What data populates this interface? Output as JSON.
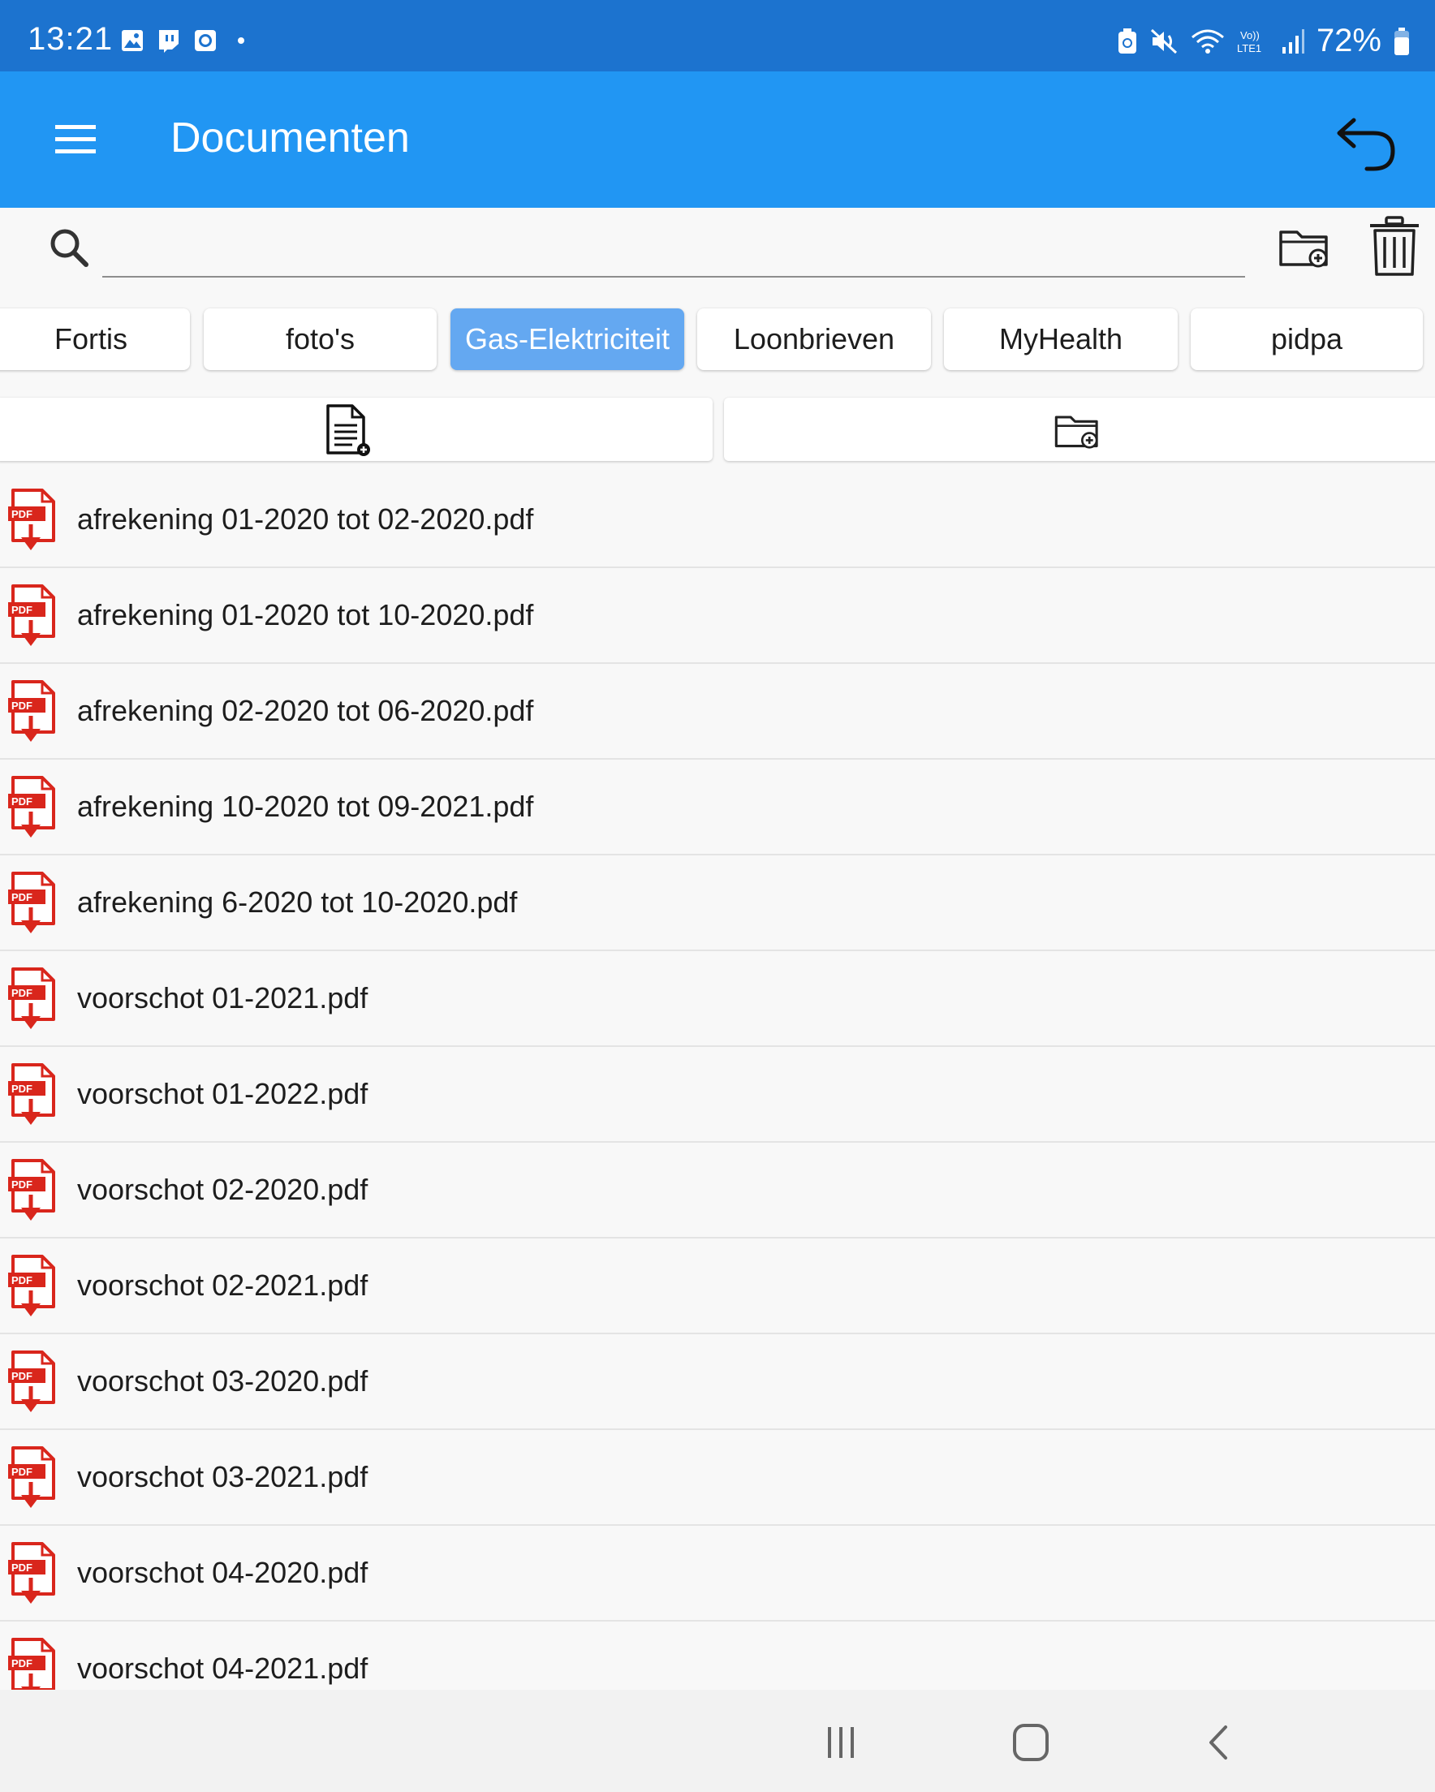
{
  "status_bar": {
    "time": "13:21",
    "battery": "72%",
    "icons": [
      "gallery-icon",
      "twitch-icon",
      "clock-app-icon",
      "dot-icon",
      "battery-saver-icon",
      "mute-icon",
      "wifi-icon",
      "volte-icon",
      "signal-icon",
      "battery-icon"
    ]
  },
  "app_bar": {
    "title": "Documenten",
    "icons": [
      "menu-icon",
      "undo-icon"
    ]
  },
  "search": {
    "value": "",
    "placeholder": "",
    "icons": [
      "search-icon",
      "new-folder-icon",
      "trash-icon"
    ]
  },
  "colors": {
    "status_bar": "#1c73cf",
    "app_bar": "#2196f3",
    "active_tab": "#64a8f1",
    "pdf_red": "#d9261c"
  },
  "tabs": [
    {
      "label": "Fortis",
      "active": false
    },
    {
      "label": "foto's",
      "active": false
    },
    {
      "label": "Gas-Elektriciteit",
      "active": true
    },
    {
      "label": "Loonbrieven",
      "active": false
    },
    {
      "label": "MyHealth",
      "active": false
    },
    {
      "label": "pidpa",
      "active": false
    }
  ],
  "actions": [
    "new-document-icon",
    "new-subfolder-icon"
  ],
  "files": [
    {
      "name": "afrekening 01-2020 tot 02-2020.pdf",
      "icon": "pdf-download-icon"
    },
    {
      "name": "afrekening 01-2020 tot 10-2020.pdf",
      "icon": "pdf-download-icon"
    },
    {
      "name": "afrekening 02-2020 tot 06-2020.pdf",
      "icon": "pdf-download-icon"
    },
    {
      "name": "afrekening 10-2020 tot 09-2021.pdf",
      "icon": "pdf-download-icon"
    },
    {
      "name": "afrekening 6-2020 tot 10-2020.pdf",
      "icon": "pdf-download-icon"
    },
    {
      "name": "voorschot 01-2021.pdf",
      "icon": "pdf-download-icon"
    },
    {
      "name": "voorschot 01-2022.pdf",
      "icon": "pdf-download-icon"
    },
    {
      "name": "voorschot 02-2020.pdf",
      "icon": "pdf-download-icon"
    },
    {
      "name": "voorschot 02-2021.pdf",
      "icon": "pdf-download-icon"
    },
    {
      "name": "voorschot 03-2020.pdf",
      "icon": "pdf-download-icon"
    },
    {
      "name": "voorschot 03-2021.pdf",
      "icon": "pdf-download-icon"
    },
    {
      "name": "voorschot 04-2020.pdf",
      "icon": "pdf-download-icon"
    },
    {
      "name": "voorschot 04-2021.pdf",
      "icon": "pdf-download-icon"
    }
  ],
  "pdf_icon_label": "PDF",
  "nav_bar": {
    "icons": [
      "recents-icon",
      "home-icon",
      "back-icon"
    ]
  }
}
